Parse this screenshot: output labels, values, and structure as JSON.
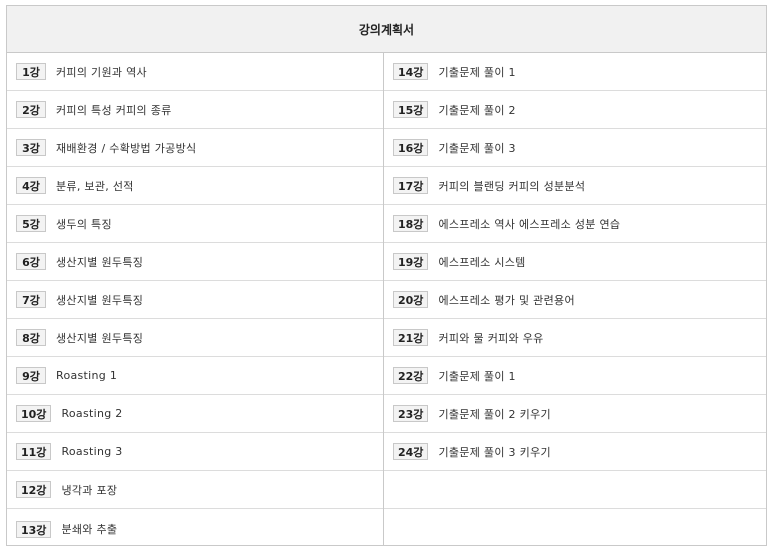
{
  "header": {
    "title": "강의계획서"
  },
  "left": [
    {
      "num": "1강",
      "title": "커피의 기원과 역사"
    },
    {
      "num": "2강",
      "title": "커피의 특성 커피의 종류"
    },
    {
      "num": "3강",
      "title": "재배환경 / 수확방법 가공방식"
    },
    {
      "num": "4강",
      "title": "분류, 보관, 선적"
    },
    {
      "num": "5강",
      "title": "생두의 특징"
    },
    {
      "num": "6강",
      "title": "생산지별 원두특징"
    },
    {
      "num": "7강",
      "title": "생산지별 원두특징"
    },
    {
      "num": "8강",
      "title": "생산지별 원두특징"
    },
    {
      "num": "9강",
      "title": "Roasting 1"
    },
    {
      "num": "10강",
      "title": "Roasting 2"
    },
    {
      "num": "11강",
      "title": "Roasting 3"
    },
    {
      "num": "12강",
      "title": "냉각과 포장"
    },
    {
      "num": "13강",
      "title": "분쇄와 추출"
    }
  ],
  "right": [
    {
      "num": "14강",
      "title": "기출문제 풀이 1"
    },
    {
      "num": "15강",
      "title": "기출문제 풀이 2"
    },
    {
      "num": "16강",
      "title": "기출문제 풀이 3"
    },
    {
      "num": "17강",
      "title": "커피의 블랜딩 커피의 성분분석"
    },
    {
      "num": "18강",
      "title": "에스프레소 역사 에스프레소 성분 연습"
    },
    {
      "num": "19강",
      "title": "에스프레소 시스템"
    },
    {
      "num": "20강",
      "title": "에스프레소 평가 및 관련용어"
    },
    {
      "num": "21강",
      "title": "커피와 물 커피와 우유"
    },
    {
      "num": "22강",
      "title": "기출문제 풀이 1"
    },
    {
      "num": "23강",
      "title": "기출문제 풀이 2 키우기"
    },
    {
      "num": "24강",
      "title": "기출문제 풀이 3 키우기"
    },
    {
      "num": "",
      "title": ""
    },
    {
      "num": "",
      "title": ""
    }
  ]
}
